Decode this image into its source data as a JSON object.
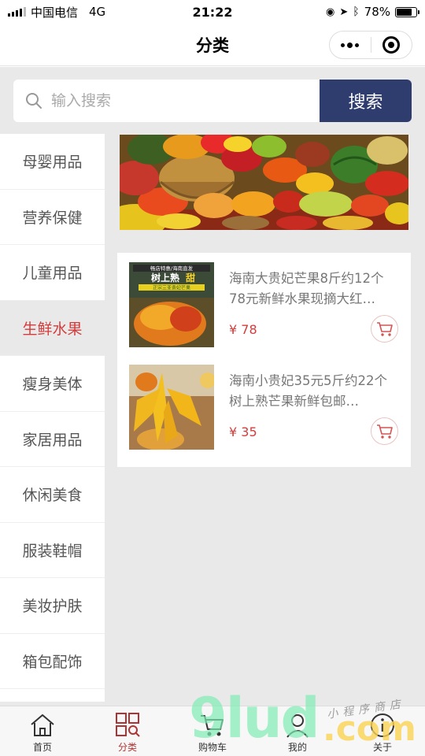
{
  "status_bar": {
    "carrier": "中国电信",
    "network": "4G",
    "time": "21:22",
    "battery_pct": "78%",
    "battery_level": 0.78
  },
  "nav": {
    "title": "分类"
  },
  "search": {
    "placeholder": "输入搜索",
    "value": "",
    "button_label": "搜索"
  },
  "sidebar": {
    "items": [
      {
        "label": "母婴用品",
        "active": false
      },
      {
        "label": "营养保健",
        "active": false
      },
      {
        "label": "儿童用品",
        "active": false
      },
      {
        "label": "生鲜水果",
        "active": true
      },
      {
        "label": "瘦身美体",
        "active": false
      },
      {
        "label": "家居用品",
        "active": false
      },
      {
        "label": "休闲美食",
        "active": false
      },
      {
        "label": "服装鞋帽",
        "active": false
      },
      {
        "label": "美妆护肤",
        "active": false
      },
      {
        "label": "箱包配饰",
        "active": false
      }
    ]
  },
  "products": [
    {
      "title": "海南大贵妃芒果8斤约12个78元新鲜水果现摘大红…",
      "price": "¥ 78",
      "image_badge_top": "畅店特惠/海南直发",
      "image_badge_main": "树上熟",
      "image_badge_accent": "甜",
      "image_badge_sub": "正宗三亚贵妃芒果"
    },
    {
      "title": "海南小贵妃35元5斤约22个树上熟芒果新鲜包邮…",
      "price": "¥ 35"
    }
  ],
  "tabs": [
    {
      "label": "首页",
      "icon": "home-icon",
      "active": false
    },
    {
      "label": "分类",
      "icon": "category-icon",
      "active": true
    },
    {
      "label": "购物车",
      "icon": "cart-icon",
      "active": false
    },
    {
      "label": "我的",
      "icon": "user-icon",
      "active": false
    },
    {
      "label": "关于",
      "icon": "info-icon",
      "active": false
    }
  ],
  "watermark": {
    "brand": "9lud",
    "domain": ".com",
    "handwriting": "小程序商店"
  },
  "colors": {
    "accent": "#d43c3c",
    "search_button": "#2f3c6e",
    "background": "#e9e9e9"
  }
}
